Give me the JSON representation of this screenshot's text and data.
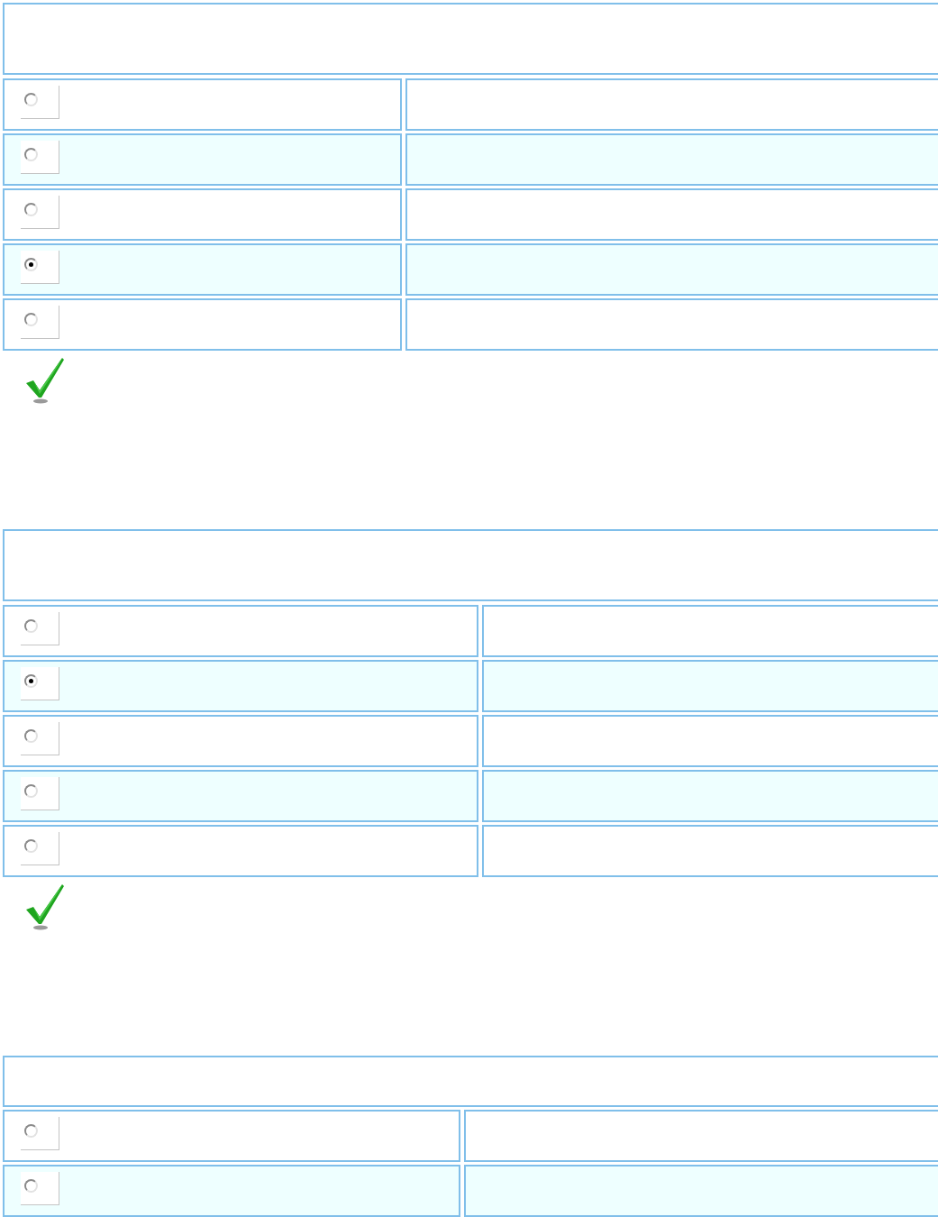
{
  "questions": [
    {
      "options": [
        {
          "selected": false
        },
        {
          "selected": false
        },
        {
          "selected": false
        },
        {
          "selected": true
        },
        {
          "selected": false
        }
      ],
      "marked_correct": true
    },
    {
      "options": [
        {
          "selected": false
        },
        {
          "selected": true
        },
        {
          "selected": false
        },
        {
          "selected": false
        },
        {
          "selected": false
        }
      ],
      "marked_correct": true
    },
    {
      "options": [
        {
          "selected": false
        },
        {
          "selected": false
        }
      ]
    }
  ]
}
